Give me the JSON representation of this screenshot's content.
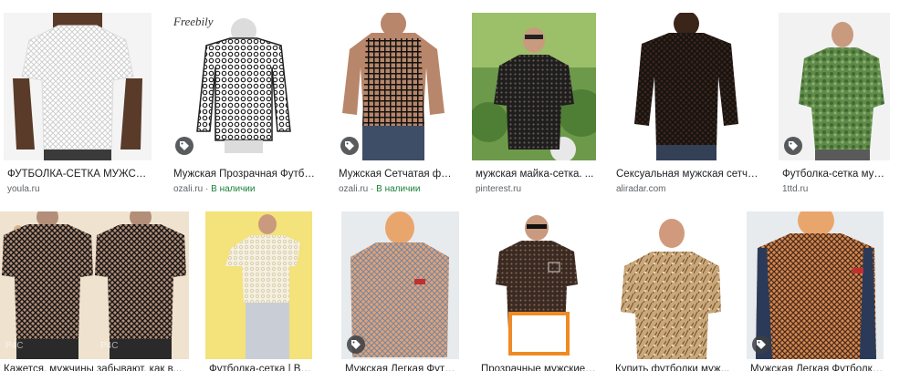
{
  "results_row1": [
    {
      "title": "ФУТБОЛКА-СЕТКА МУЖСКАЯ...",
      "source": "youla.ru",
      "stock": ""
    },
    {
      "title": "Мужская Прозрачная Футболка...",
      "source": "ozali.ru",
      "stock": "В наличии"
    },
    {
      "title": "Мужская Сетчатая футболка...",
      "source": "ozali.ru",
      "stock": "В наличии"
    },
    {
      "title": "мужская майка-сетка. ...",
      "source": "pinterest.ru",
      "stock": ""
    },
    {
      "title": "Сексуальная мужская сетчатая...",
      "source": "aliradar.com",
      "stock": ""
    },
    {
      "title": "Футболка-сетка мужская...",
      "source": "1ttd.ru",
      "stock": ""
    }
  ],
  "results_row2": [
    {
      "title": "Кажется, мужчины забывают, как в..."
    },
    {
      "title": "Футболка-сетка | Вязание..."
    },
    {
      "title": "Мужская Легкая Футболка..."
    },
    {
      "title": "Прозрачные мужские футболки..."
    },
    {
      "title": "Купить футболки муж..."
    },
    {
      "title": "Мужская Легкая Футболка Бе..."
    }
  ],
  "stock_separator": " · ",
  "colors": {
    "title": "#202124",
    "source": "#5f6368",
    "in_stock": "#188038",
    "highlight_box": "#f08a24"
  },
  "icons": {
    "badge": "tag-icon"
  }
}
